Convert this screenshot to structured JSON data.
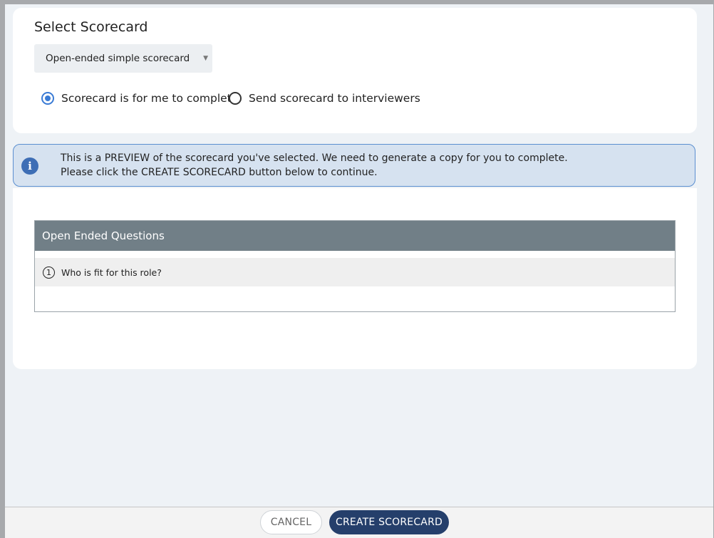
{
  "scorecard": {
    "section_title": "Select Scorecard",
    "selected_template": "Open-ended simple scorecard",
    "radio_options": [
      {
        "label": "Scorecard is for me to complete",
        "checked": true
      },
      {
        "label": "Send scorecard to interviewers",
        "checked": false
      }
    ]
  },
  "alert": {
    "icon": "info-icon",
    "line1": "This is a PREVIEW of the scorecard you've selected. We need to generate a copy for you to complete.",
    "line2": "Please click the CREATE SCORECARD button below to continue."
  },
  "preview": {
    "header": "Open Ended Questions",
    "questions": [
      {
        "number": "1",
        "text": "Who is fit for this role?"
      }
    ]
  },
  "footer": {
    "cancel_label": "CANCEL",
    "create_label": "CREATE SCORECARD"
  },
  "colors": {
    "primary": "#253f6b",
    "accent": "#3a7bd5",
    "info_bg": "#d6e2f0",
    "table_header": "#717f87"
  }
}
